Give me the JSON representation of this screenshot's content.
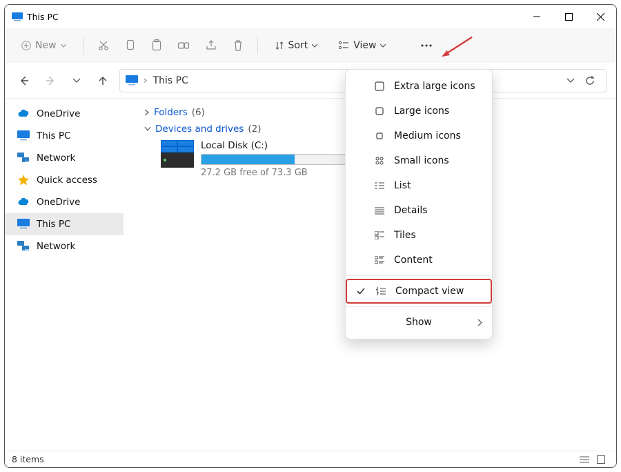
{
  "window": {
    "title": "This PC"
  },
  "toolbar": {
    "new": "New",
    "sort": "Sort",
    "view": "View"
  },
  "breadcrumb": {
    "location": "This PC"
  },
  "sidebar": {
    "items": [
      {
        "icon": "cloud",
        "label": "OneDrive",
        "color": "#0a84d6"
      },
      {
        "icon": "monitor",
        "label": "This PC",
        "color": "#1a7ce0"
      },
      {
        "icon": "network",
        "label": "Network",
        "color": "#2b7fc4"
      },
      {
        "icon": "star",
        "label": "Quick access",
        "color": "#f3b300"
      },
      {
        "icon": "cloud",
        "label": "OneDrive",
        "color": "#0a84d6"
      },
      {
        "icon": "monitor",
        "label": "This PC",
        "color": "#1a7ce0",
        "selected": true
      },
      {
        "icon": "network",
        "label": "Network",
        "color": "#2b7fc4"
      }
    ]
  },
  "groups": {
    "folders": {
      "label": "Folders",
      "count": "(6)"
    },
    "drives": {
      "label": "Devices and drives",
      "count": "(2)"
    }
  },
  "drive": {
    "name": "Local Disk (C:)",
    "sub": "27.2 GB free of 73.3 GB",
    "fill_percent": 62
  },
  "view_menu": {
    "items": [
      {
        "label": "Extra large icons"
      },
      {
        "label": "Large icons"
      },
      {
        "label": "Medium icons"
      },
      {
        "label": "Small icons"
      },
      {
        "label": "List"
      },
      {
        "label": "Details"
      },
      {
        "label": "Tiles"
      },
      {
        "label": "Content"
      }
    ],
    "compact": "Compact view",
    "show": "Show"
  },
  "status": {
    "items": "8 items"
  }
}
